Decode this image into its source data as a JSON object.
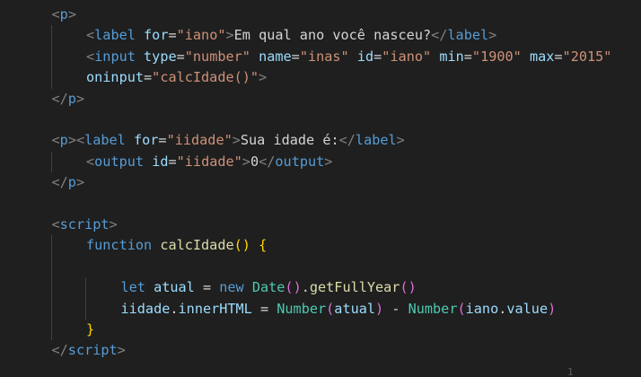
{
  "editor": {
    "lines": [
      {
        "indent": 1,
        "tokens": [
          [
            "punct",
            "<"
          ],
          [
            "tag",
            "p"
          ],
          [
            "punct",
            ">"
          ]
        ]
      },
      {
        "indent": 2,
        "tokens": [
          [
            "punct",
            "<"
          ],
          [
            "tag",
            "label"
          ],
          [
            "text",
            " "
          ],
          [
            "attr",
            "for"
          ],
          [
            "eq",
            "="
          ],
          [
            "str",
            "\"iano\""
          ],
          [
            "punct",
            ">"
          ],
          [
            "text",
            "Em qual ano você nasceu?"
          ],
          [
            "punct",
            "</"
          ],
          [
            "tag",
            "label"
          ],
          [
            "punct",
            ">"
          ]
        ]
      },
      {
        "indent": 2,
        "tokens": [
          [
            "punct",
            "<"
          ],
          [
            "tag",
            "input"
          ],
          [
            "text",
            " "
          ],
          [
            "attr",
            "type"
          ],
          [
            "eq",
            "="
          ],
          [
            "str",
            "\"number\""
          ],
          [
            "text",
            " "
          ],
          [
            "attr",
            "name"
          ],
          [
            "eq",
            "="
          ],
          [
            "str",
            "\"inas\""
          ],
          [
            "text",
            " "
          ],
          [
            "attr",
            "id"
          ],
          [
            "eq",
            "="
          ],
          [
            "str",
            "\"iano\""
          ],
          [
            "text",
            " "
          ],
          [
            "attr",
            "min"
          ],
          [
            "eq",
            "="
          ],
          [
            "str",
            "\"1900\""
          ],
          [
            "text",
            " "
          ],
          [
            "attr",
            "max"
          ],
          [
            "eq",
            "="
          ],
          [
            "str",
            "\"2015\""
          ]
        ]
      },
      {
        "indent": 2,
        "tokens": [
          [
            "attr",
            "oninput"
          ],
          [
            "eq",
            "="
          ],
          [
            "str",
            "\"calcIdade()\""
          ],
          [
            "punct",
            ">"
          ]
        ]
      },
      {
        "indent": 1,
        "tokens": [
          [
            "punct",
            "</"
          ],
          [
            "tag",
            "p"
          ],
          [
            "punct",
            ">"
          ]
        ]
      },
      {
        "indent": 0,
        "tokens": []
      },
      {
        "indent": 1,
        "tokens": [
          [
            "punct",
            "<"
          ],
          [
            "tag",
            "p"
          ],
          [
            "punct",
            "><"
          ],
          [
            "tag",
            "label"
          ],
          [
            "text",
            " "
          ],
          [
            "attr",
            "for"
          ],
          [
            "eq",
            "="
          ],
          [
            "str",
            "\"iidade\""
          ],
          [
            "punct",
            ">"
          ],
          [
            "text",
            "Sua idade é:"
          ],
          [
            "punct",
            "</"
          ],
          [
            "tag",
            "label"
          ],
          [
            "punct",
            ">"
          ]
        ]
      },
      {
        "indent": 2,
        "tokens": [
          [
            "punct",
            "<"
          ],
          [
            "tag",
            "output"
          ],
          [
            "text",
            " "
          ],
          [
            "attr",
            "id"
          ],
          [
            "eq",
            "="
          ],
          [
            "str",
            "\"iidade\""
          ],
          [
            "punct",
            ">"
          ],
          [
            "text",
            "0"
          ],
          [
            "punct",
            "</"
          ],
          [
            "tag",
            "output"
          ],
          [
            "punct",
            ">"
          ]
        ]
      },
      {
        "indent": 1,
        "tokens": [
          [
            "punct",
            "</"
          ],
          [
            "tag",
            "p"
          ],
          [
            "punct",
            ">"
          ]
        ]
      },
      {
        "indent": 0,
        "tokens": []
      },
      {
        "indent": 1,
        "tokens": [
          [
            "punct",
            "<"
          ],
          [
            "tag",
            "script"
          ],
          [
            "punct",
            ">"
          ]
        ]
      },
      {
        "indent": 2,
        "tokens": [
          [
            "kw",
            "function"
          ],
          [
            "text",
            " "
          ],
          [
            "fn",
            "calcIdade"
          ],
          [
            "brace1",
            "()"
          ],
          [
            "text",
            " "
          ],
          [
            "brace1",
            "{"
          ]
        ]
      },
      {
        "indent": 0,
        "tokens": []
      },
      {
        "indent": 3,
        "tokens": [
          [
            "kw",
            "let"
          ],
          [
            "text",
            " "
          ],
          [
            "var",
            "atual"
          ],
          [
            "text",
            " = "
          ],
          [
            "kw",
            "new"
          ],
          [
            "text",
            " "
          ],
          [
            "cls",
            "Date"
          ],
          [
            "brace2",
            "()"
          ],
          [
            "text",
            "."
          ],
          [
            "fn",
            "getFullYear"
          ],
          [
            "brace2",
            "()"
          ]
        ]
      },
      {
        "indent": 3,
        "tokens": [
          [
            "var",
            "iidade"
          ],
          [
            "text",
            "."
          ],
          [
            "var",
            "innerHTML"
          ],
          [
            "text",
            " = "
          ],
          [
            "cls",
            "Number"
          ],
          [
            "brace2",
            "("
          ],
          [
            "var",
            "atual"
          ],
          [
            "brace2",
            ")"
          ],
          [
            "text",
            " - "
          ],
          [
            "cls",
            "Number"
          ],
          [
            "brace2",
            "("
          ],
          [
            "var",
            "iano"
          ],
          [
            "text",
            "."
          ],
          [
            "var",
            "value"
          ],
          [
            "brace2",
            ")"
          ]
        ]
      },
      {
        "indent": 2,
        "tokens": [
          [
            "brace1",
            "}"
          ]
        ]
      },
      {
        "indent": 1,
        "tokens": [
          [
            "punct",
            "</"
          ],
          [
            "tag",
            "script"
          ],
          [
            "punct",
            ">"
          ]
        ]
      }
    ],
    "ghost_text": "1"
  }
}
